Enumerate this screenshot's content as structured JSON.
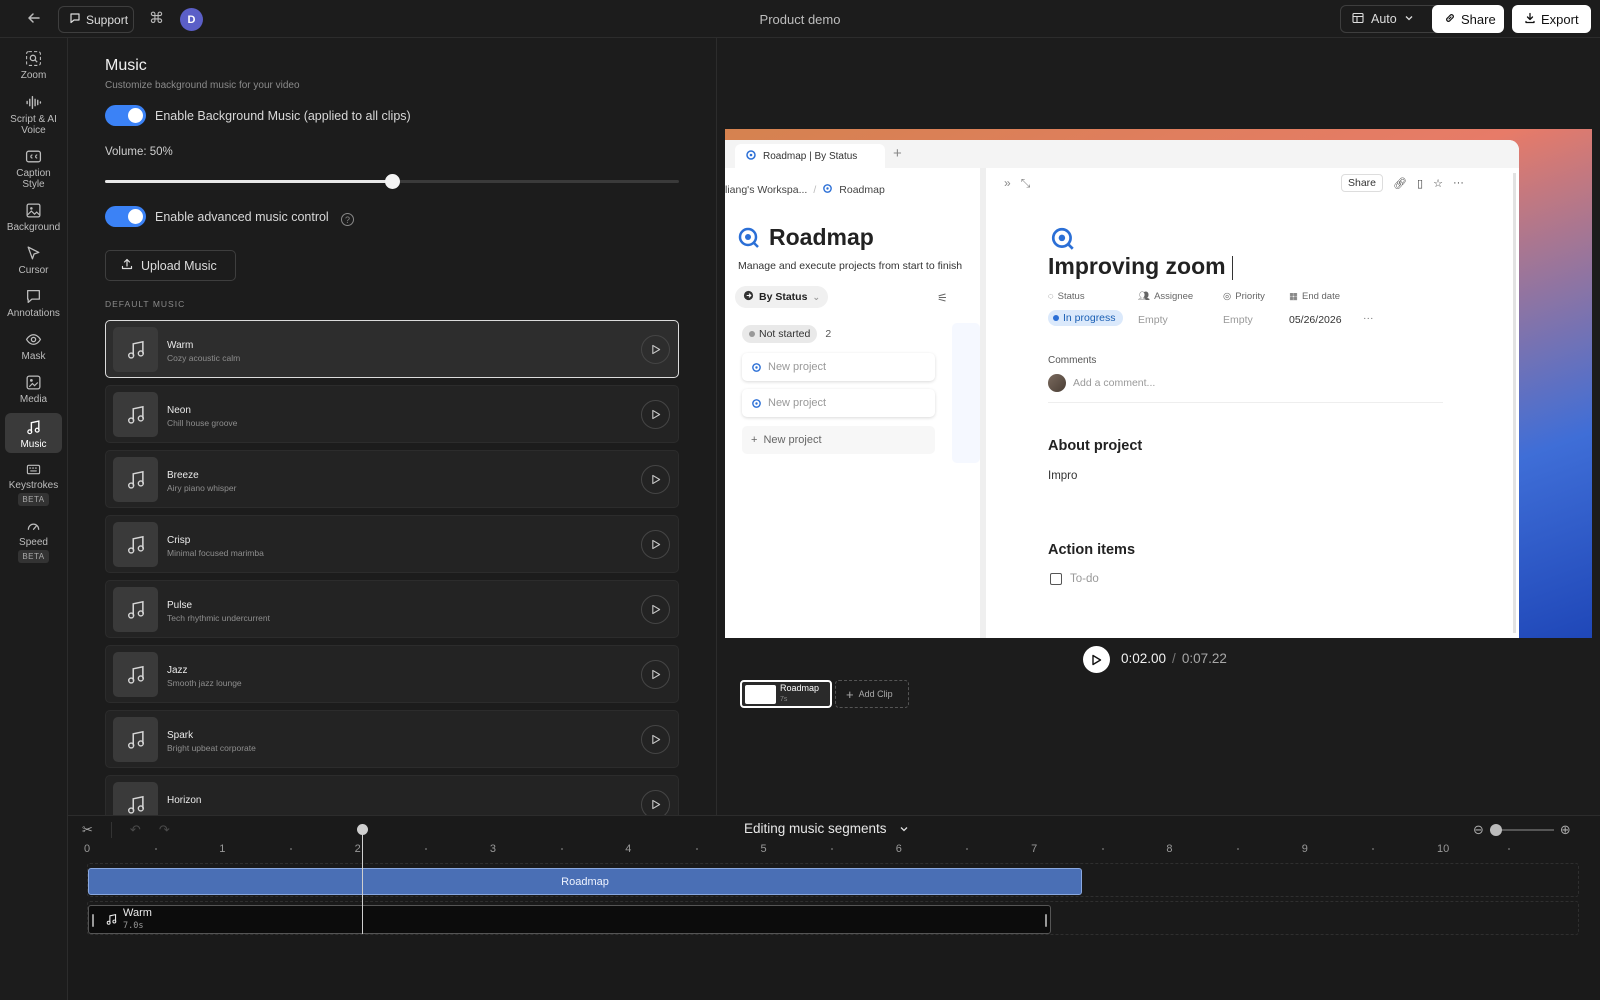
{
  "topbar": {
    "support_label": "Support",
    "avatar_initial": "D",
    "project_title": "Product demo",
    "layout_select": "Auto",
    "share_label": "Share",
    "export_label": "Export"
  },
  "sidebar": {
    "items": [
      {
        "label": "Zoom",
        "icon": "zoom-icon"
      },
      {
        "label": "Script & AI Voice",
        "icon": "waveform-icon"
      },
      {
        "label": "Caption Style",
        "icon": "caption-icon"
      },
      {
        "label": "Background",
        "icon": "image-icon"
      },
      {
        "label": "Cursor",
        "icon": "cursor-icon"
      },
      {
        "label": "Annotations",
        "icon": "comment-icon"
      },
      {
        "label": "Mask",
        "icon": "eye-icon"
      },
      {
        "label": "Media",
        "icon": "media-icon"
      },
      {
        "label": "Music",
        "icon": "music-icon",
        "active": true
      },
      {
        "label": "Keystrokes",
        "icon": "keyboard-icon",
        "badge": "BETA"
      },
      {
        "label": "Speed",
        "icon": "gauge-icon",
        "badge": "BETA"
      }
    ]
  },
  "music_panel": {
    "title": "Music",
    "subtitle": "Customize background music for your video",
    "enable_bg_label": "Enable Background Music (applied to all clips)",
    "enable_bg_on": true,
    "volume_label": "Volume: 50%",
    "volume_fraction": 0.5,
    "advanced_label": "Enable advanced music control",
    "advanced_on": true,
    "help_glyph": "?",
    "upload_label": "Upload Music",
    "section_heading": "DEFAULT MUSIC",
    "tracks": [
      {
        "name": "Warm",
        "desc": "Cozy acoustic calm",
        "selected": true
      },
      {
        "name": "Neon",
        "desc": "Chill house groove"
      },
      {
        "name": "Breeze",
        "desc": "Airy piano whisper"
      },
      {
        "name": "Crisp",
        "desc": "Minimal focused marimba"
      },
      {
        "name": "Pulse",
        "desc": "Tech rhythmic undercurrent"
      },
      {
        "name": "Jazz",
        "desc": "Smooth jazz lounge"
      },
      {
        "name": "Spark",
        "desc": "Bright upbeat corporate"
      },
      {
        "name": "Horizon",
        "desc": ""
      }
    ]
  },
  "preview": {
    "browser_tab": "Roadmap | By Status",
    "crumb_workspace": "liang's Workspa...",
    "crumb_sep": "/",
    "crumb_page": "Roadmap",
    "roadmap_title": "Roadmap",
    "roadmap_sub": "Manage and execute projects from start to finish",
    "view_label": "By Status",
    "col_not_started": "Not started",
    "col_count": "2",
    "new_project_1": "New project",
    "new_project_2": "New project",
    "new_project_add": "New project",
    "share_mini": "Share",
    "page_title": "Improving zoom",
    "props": {
      "status_h": "Status",
      "status_v": "In progress",
      "assignee_h": "Assignee",
      "assignee_v": "Empty",
      "priority_h": "Priority",
      "priority_v": "Empty",
      "enddate_h": "End date",
      "enddate_v": "05/26/2026",
      "more": "···"
    },
    "comments_label": "Comments",
    "comment_placeholder": "Add a comment...",
    "about_heading": "About project",
    "about_text": "Impro",
    "action_heading": "Action items",
    "todo_label": "To-do"
  },
  "player": {
    "current_time": "0:02.00",
    "separator": "/",
    "duration": "0:07.22",
    "clip_name": "Roadmap",
    "clip_duration": "7s",
    "add_clip_label": "Add Clip"
  },
  "timeline": {
    "mode_label": "Editing music segments",
    "ticks": [
      "0",
      "1",
      "2",
      "3",
      "4",
      "5",
      "6",
      "7",
      "8",
      "9",
      "10"
    ],
    "video_segment_label": "Roadmap",
    "music_segment_name": "Warm",
    "music_segment_duration": "7.0s",
    "playhead_seconds": 2.0
  }
}
